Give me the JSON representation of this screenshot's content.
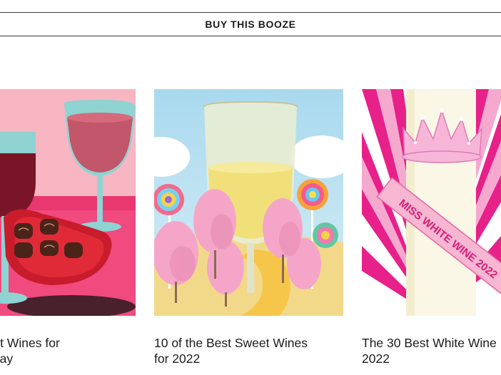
{
  "banner": {
    "label": "BUY THIS BOOZE"
  },
  "cards": [
    {
      "title": "Best Wines for\n's Day",
      "image": "wine-and-chocolates-illustration"
    },
    {
      "title": "10 of the Best Sweet Wines\nfor 2022",
      "image": "sweet-wine-candyland-illustration"
    },
    {
      "title": "The 30 Best White Wine\n2022",
      "image": "miss-white-wine-illustration",
      "sash_text": "MISS WHITE WINE 2022"
    }
  ],
  "colors": {
    "pink_bg": "#f7b6c2",
    "hot_pink": "#e8208a",
    "sky_blue": "#a9d9ee",
    "wine_red": "#7a1528",
    "glass_teal": "#8fd3d3"
  }
}
